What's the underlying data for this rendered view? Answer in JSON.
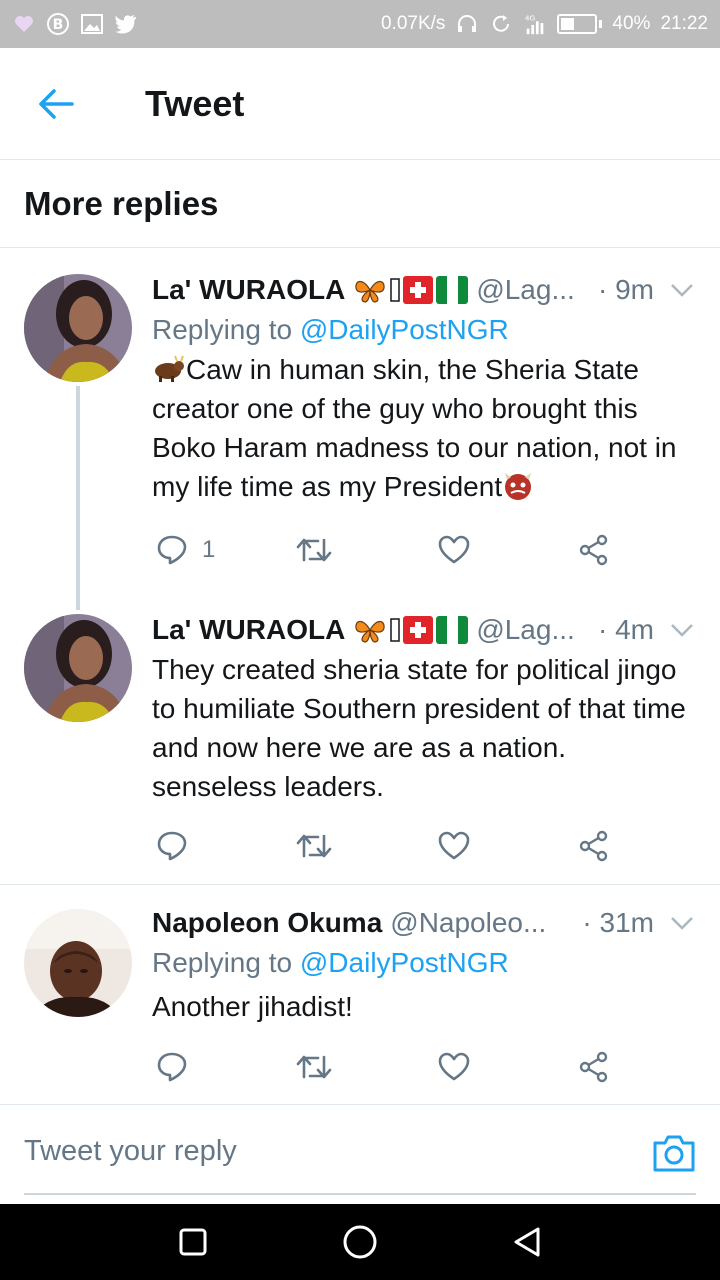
{
  "status_bar": {
    "network_speed": "0.07K/s",
    "network_type": "4G",
    "battery": "40%",
    "battery_level": 0.4,
    "time": "21:22"
  },
  "header": {
    "title": "Tweet"
  },
  "section": {
    "title": "More replies"
  },
  "tweets": [
    {
      "name": "La' WURAOLA",
      "handle": "@Lag...",
      "time": "· 9m",
      "replying_prefix": "Replying to ",
      "replying_handle": "@DailyPostNGR",
      "text": "Caw in human skin, the Sheria State creator one of the guy who brought this Boko Haram madness to our nation, not in my life time as my President",
      "reply_count": "1"
    },
    {
      "name": "La' WURAOLA",
      "handle": "@Lag...",
      "time": "· 4m",
      "text": "They created sheria state for political jingo to humiliate Southern president of that time  and now here we are as a nation. senseless leaders.",
      "reply_count": ""
    },
    {
      "name": "Napoleon Okuma",
      "handle": "@Napoleo...",
      "time": "· 31m",
      "replying_prefix": "Replying to ",
      "replying_handle": "@DailyPostNGR",
      "text": "Another jihadist!",
      "reply_count": ""
    }
  ],
  "reply_bar": {
    "placeholder": "Tweet your reply"
  },
  "colors": {
    "accent": "#1da1f2",
    "secondary_text": "#657786",
    "primary_text": "#14171a",
    "divider": "#e1e8ed",
    "status_bar": "#bdbdbd",
    "nav_bar": "#000000"
  },
  "icons": {
    "back": "arrow-left-icon",
    "reply": "reply-icon",
    "retweet": "retweet-icon",
    "like": "heart-icon",
    "share": "share-icon",
    "caret": "chevron-down-icon",
    "camera": "camera-icon"
  }
}
